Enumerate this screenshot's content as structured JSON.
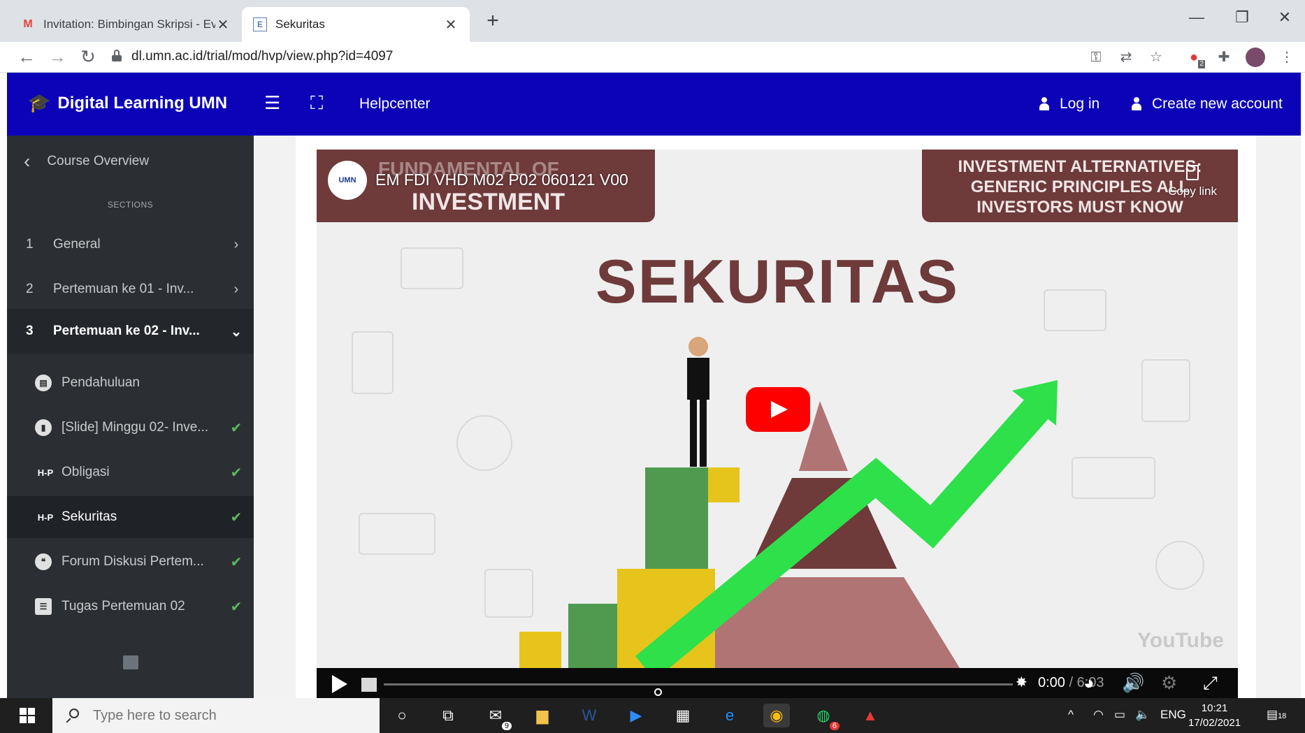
{
  "browser": {
    "tabs": [
      {
        "title": "Invitation: Bimbingan Skripsi - Ev",
        "favicon": "gmail-icon"
      },
      {
        "title": "Sekuritas",
        "favicon": "moodle-page-icon"
      }
    ],
    "new_tab_symbol": "+",
    "url": "dl.umn.ac.id/trial/mod/hvp/view.php?id=4097",
    "extension_badge": "2"
  },
  "navbar": {
    "brand": "Digital Learning UMN",
    "helpcenter": "Helpcenter",
    "login": "Log in",
    "create_account": "Create new account",
    "bg_color": "#0c02b7"
  },
  "sidebar": {
    "back_label": "Course Overview",
    "sections_heading": "SECTIONS",
    "sections": [
      {
        "num": "1",
        "label": "General"
      },
      {
        "num": "2",
        "label": "Pertemuan ke 01 - Inv..."
      },
      {
        "num": "3",
        "label": "Pertemuan ke 02 - Inv..."
      }
    ],
    "activities": [
      {
        "icon": "page-icon",
        "label": "Pendahuluan",
        "completed": false
      },
      {
        "icon": "file-icon",
        "label": "[Slide] Minggu 02- Inve...",
        "completed": true
      },
      {
        "icon": "h5p-icon",
        "badge": "H-P",
        "label": "Obligasi",
        "completed": true
      },
      {
        "icon": "h5p-icon",
        "badge": "H-P",
        "label": "Sekuritas",
        "completed": true
      },
      {
        "icon": "forum-icon",
        "label": "Forum Diskusi Pertem...",
        "completed": true
      },
      {
        "icon": "assign-icon",
        "label": "Tugas Pertemuan 02",
        "completed": true
      }
    ]
  },
  "video": {
    "yt_title": "EM FDI VHD M02 P02 060121 V00",
    "channel_logo_text": "UMN",
    "copy_link": "Copy link",
    "banner_left_line1": "FUNDAMENTAL OF",
    "banner_left_line2": "INVESTMENT",
    "banner_right": "INVESTMENT ALTERNATIVES: GENERIC PRINCIPLES ALL INVESTORS MUST KNOW",
    "headline": "SEKURITAS",
    "watermark": "YouTube",
    "time_current": "0:00",
    "time_separator": " / ",
    "time_duration": "6:03",
    "progress": 0.0
  },
  "taskbar": {
    "search_placeholder": "Type here to search",
    "mail_badge": "9",
    "whatsapp_badge": "6",
    "language": "ENG",
    "time": "10:21",
    "date": "17/02/2021",
    "notification_badge": "18"
  }
}
